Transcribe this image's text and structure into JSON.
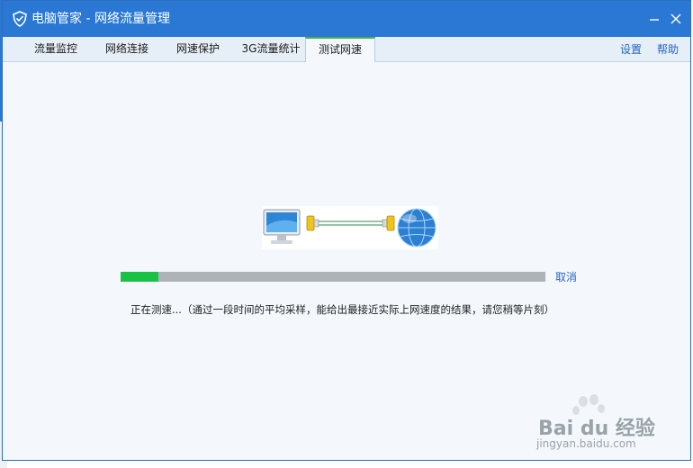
{
  "window": {
    "title": "电脑管家 - 网络流量管理",
    "accent": "#2a78d4"
  },
  "tabs": [
    {
      "label": "流量监控",
      "active": false
    },
    {
      "label": "网络连接",
      "active": false
    },
    {
      "label": "网速保护",
      "active": false
    },
    {
      "label": "3G流量统计",
      "active": false
    },
    {
      "label": "测试网速",
      "active": true
    }
  ],
  "links": {
    "settings": "设置",
    "help": "帮助"
  },
  "speed_test": {
    "progress_percent": 9,
    "progress_color": "#19c245",
    "cancel_label": "取消",
    "status_text": "正在测速...（通过一段时间的平均采样，能给出最接近实际上网速度的结果，请您稍等片刻）"
  },
  "watermark": {
    "logo_text": "Bai du 经验",
    "url": "jingyan.baidu.com"
  }
}
